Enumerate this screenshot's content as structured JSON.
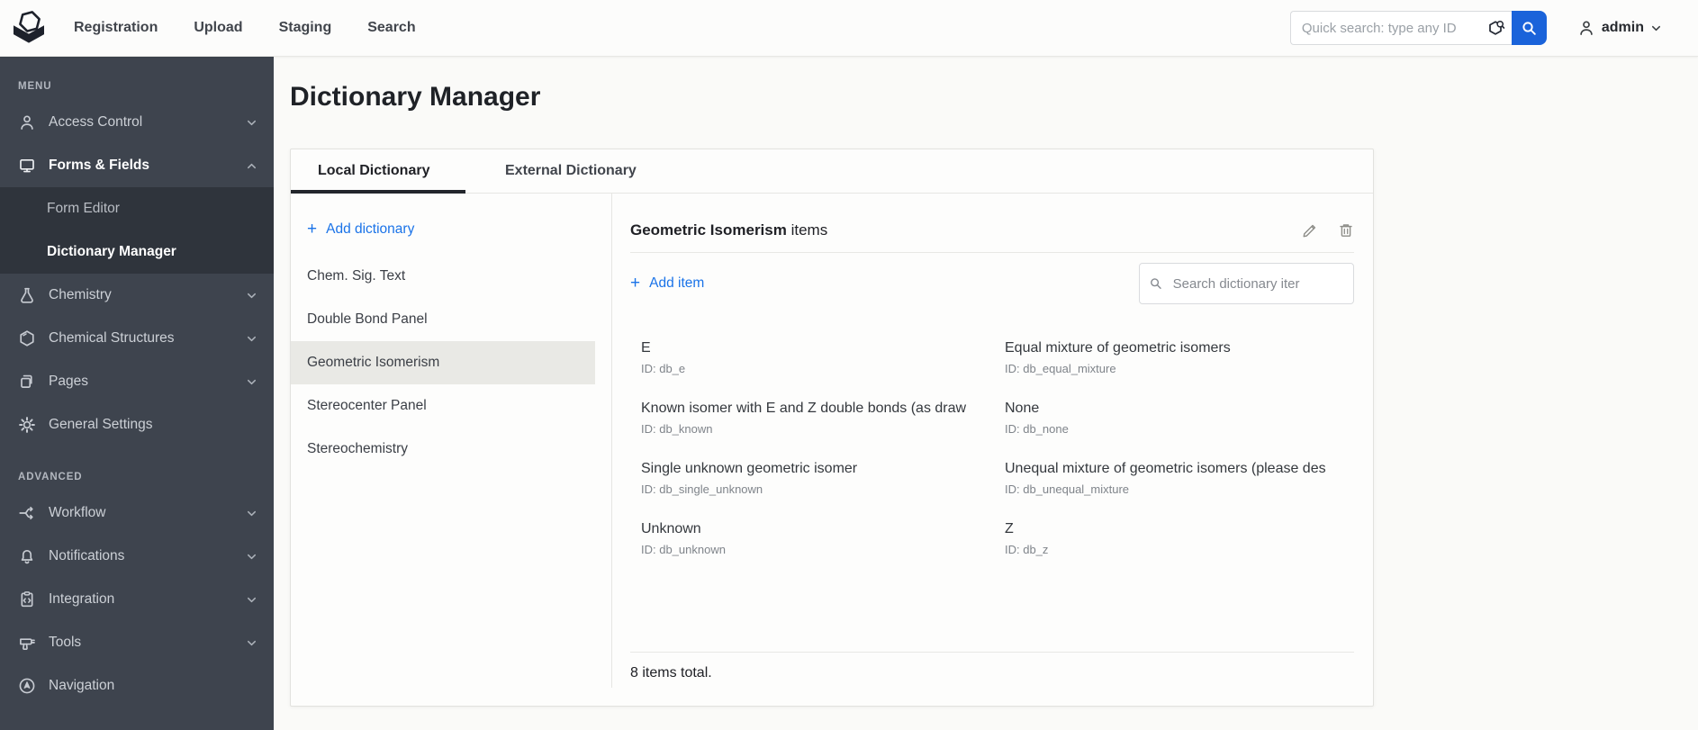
{
  "colors": {
    "accent_link": "#1a73e8",
    "search_button": "#1a63da",
    "sidebar_bg": "#3e444e",
    "sidebar_submenu_bg": "#2f343c",
    "selected_row_bg": "#e9e9e5",
    "tab_underline": "#23262c"
  },
  "ui": {
    "plus_glyph": "+"
  },
  "navbar": {
    "menu": [
      {
        "label": "Registration"
      },
      {
        "label": "Upload"
      },
      {
        "label": "Staging"
      },
      {
        "label": "Search"
      }
    ],
    "quick_search": {
      "placeholder": "Quick search: type any ID"
    },
    "user": {
      "name": "admin"
    }
  },
  "sidebar": {
    "menu_label": "MENU",
    "advanced_label": "ADVANCED",
    "menu_items": [
      {
        "label": "Access Control",
        "icon": "person",
        "expandable": true
      },
      {
        "label": "Forms & Fields",
        "icon": "monitor",
        "expandable": true,
        "expanded": true,
        "active": true
      },
      {
        "label": "Chemistry",
        "icon": "flask",
        "expandable": true
      },
      {
        "label": "Chemical Structures",
        "icon": "benzene-hexagon",
        "expandable": true
      },
      {
        "label": "Pages",
        "icon": "pages",
        "expandable": true
      },
      {
        "label": "General Settings",
        "icon": "gear",
        "expandable": false
      }
    ],
    "submenu_items": [
      {
        "label": "Form Editor"
      },
      {
        "label": "Dictionary Manager",
        "active": true
      }
    ],
    "advanced_items": [
      {
        "label": "Workflow",
        "icon": "workflow",
        "expandable": true
      },
      {
        "label": "Notifications",
        "icon": "bell",
        "expandable": true
      },
      {
        "label": "Integration",
        "icon": "clipboard-code",
        "expandable": true
      },
      {
        "label": "Tools",
        "icon": "drill",
        "expandable": true
      },
      {
        "label": "Navigation",
        "icon": "compass-arrow",
        "expandable": false
      }
    ]
  },
  "page": {
    "title": "Dictionary Manager"
  },
  "tabs": [
    {
      "label": "Local Dictionary",
      "active": true
    },
    {
      "label": "External Dictionary",
      "active": false
    }
  ],
  "dictionary_panel": {
    "add_label": "Add dictionary",
    "items": [
      {
        "label": "Chem. Sig. Text",
        "selected": false
      },
      {
        "label": "Double Bond Panel",
        "selected": false
      },
      {
        "label": "Geometric Isomerism",
        "selected": true
      },
      {
        "label": "Stereocenter Panel",
        "selected": false
      },
      {
        "label": "Stereochemistry",
        "selected": false
      }
    ]
  },
  "detail": {
    "title_name": "Geometric Isomerism",
    "title_suffix": " items",
    "add_label": "Add item",
    "search_placeholder": "Search dictionary iter",
    "items": [
      {
        "name": "E",
        "id_text": "ID: db_e"
      },
      {
        "name": "Equal mixture of geometric isomers",
        "id_text": "ID: db_equal_mixture"
      },
      {
        "name": "Known isomer with E and Z double bonds (as draw",
        "id_text": "ID: db_known"
      },
      {
        "name": "None",
        "id_text": "ID: db_none"
      },
      {
        "name": "Single unknown geometric isomer",
        "id_text": "ID: db_single_unknown"
      },
      {
        "name": "Unequal mixture of geometric isomers (please des",
        "id_text": "ID: db_unequal_mixture"
      },
      {
        "name": "Unknown",
        "id_text": "ID: db_unknown"
      },
      {
        "name": "Z",
        "id_text": "ID: db_z"
      }
    ],
    "footer": "8 items total."
  }
}
